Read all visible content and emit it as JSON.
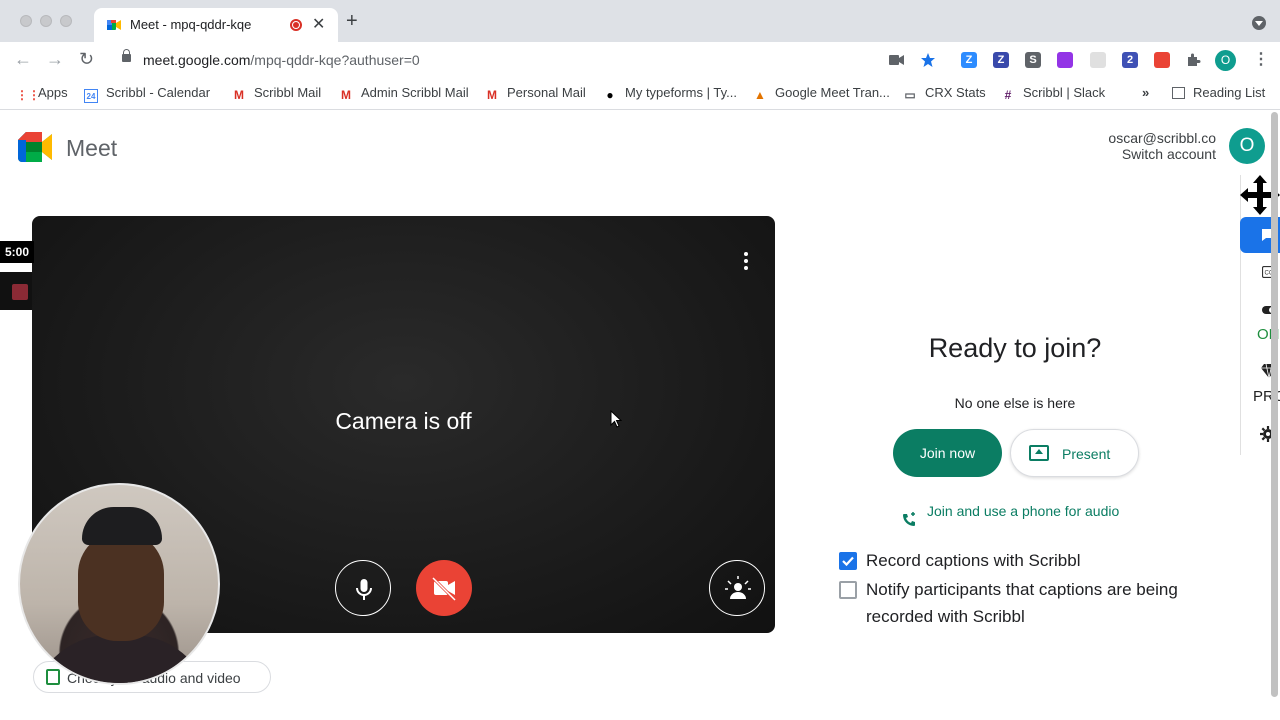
{
  "browser": {
    "tab_title": "Meet - mpq-qddr-kqe",
    "tab_close": "✕",
    "new_tab": "+",
    "url_host": "meet.google.com",
    "url_path": "/mpq-qddr-kqe?authuser=0",
    "profile_initial": "O",
    "extensions": [
      {
        "icon": "zoom-icon",
        "color": "#2d8cff",
        "letter": "Z"
      },
      {
        "icon": "z-icon",
        "color": "#3949ab",
        "letter": "Z"
      },
      {
        "icon": "s-icon",
        "color": "#5f6368",
        "letter": "S"
      },
      {
        "icon": "purple-icon",
        "color": "#9334e6",
        "letter": ""
      },
      {
        "icon": "grid-icon",
        "color": "#e0e0e0",
        "letter": ""
      },
      {
        "icon": "badge-icon",
        "color": "#3f51b5",
        "letter": "2"
      },
      {
        "icon": "red-icon",
        "color": "#ea4335",
        "letter": ""
      }
    ]
  },
  "bookmarks": [
    {
      "label": "Apps",
      "icon": "apps-grid-icon"
    },
    {
      "label": "Scribbl - Calendar",
      "icon": "calendar-icon"
    },
    {
      "label": "Scribbl Mail",
      "icon": "gmail-icon"
    },
    {
      "label": "Admin Scribbl Mail",
      "icon": "gmail-icon"
    },
    {
      "label": "Personal Mail",
      "icon": "gmail-icon"
    },
    {
      "label": "My typeforms | Ty...",
      "icon": "typeform-icon"
    },
    {
      "label": "Google Meet Tran...",
      "icon": "meet-icon"
    },
    {
      "label": "CRX Stats",
      "icon": "folder-icon"
    },
    {
      "label": "Scribbl | Slack",
      "icon": "slack-icon"
    }
  ],
  "bookmarks_more": "»",
  "reading_list": "Reading List",
  "app": {
    "name": "Meet"
  },
  "account": {
    "email": "oscar@scribbl.co",
    "switch_label": "Switch account",
    "avatar_initial": "O"
  },
  "preview": {
    "camera_off_text": "Camera is off",
    "check_av_label": "Check your audio and video"
  },
  "overlay": {
    "timer": "5:00"
  },
  "join": {
    "heading": "Ready to join?",
    "status": "No one else is here",
    "join_button": "Join now",
    "present_button": "Present",
    "phone_link": "Join and use a phone for audio"
  },
  "scribbl": {
    "record_captions_label": "Record captions with Scribbl",
    "record_captions_checked": true,
    "notify_label": "Notify participants that captions are being recorded with Scribbl",
    "notify_checked": false,
    "side_on_label": "ON",
    "side_pro_label": "PRO"
  },
  "colors": {
    "accent_green": "#0b7d63",
    "checkbox_blue": "#1a73e8",
    "camera_off_red": "#ea4335"
  }
}
